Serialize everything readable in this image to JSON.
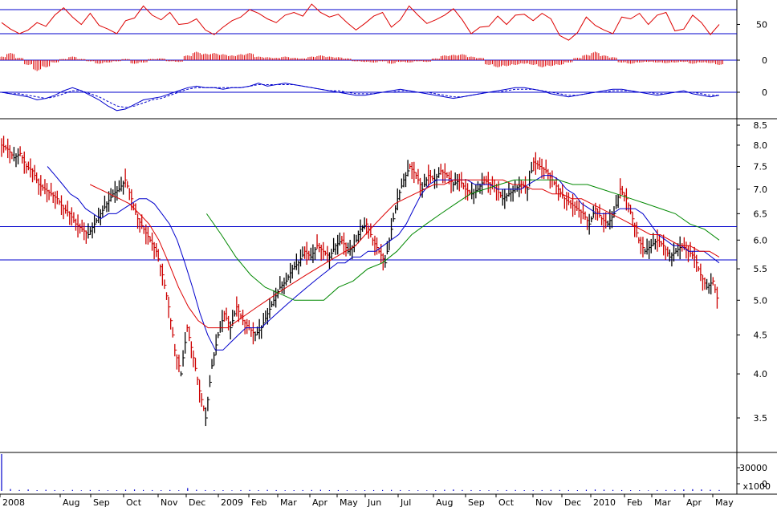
{
  "chart_data": [
    {
      "type": "line",
      "panel": "oscillator",
      "hlines": [
        66,
        40
      ],
      "y_ticks": [
        "50"
      ],
      "series": [
        {
          "color": "#dd0000",
          "values": [
            52,
            45,
            40,
            44,
            52,
            48,
            60,
            68,
            58,
            50,
            62,
            49,
            45,
            40,
            54,
            57,
            70,
            60,
            55,
            63,
            50,
            51,
            56,
            44,
            39,
            47,
            54,
            58,
            66,
            62,
            56,
            52,
            60,
            63,
            59,
            72,
            63,
            58,
            61,
            52,
            44,
            51,
            59,
            63,
            47,
            55,
            70,
            60,
            51,
            55,
            60,
            67,
            55,
            40,
            47,
            48,
            59,
            50,
            60,
            61,
            54,
            62,
            56,
            38,
            33,
            41,
            58,
            49,
            44,
            40,
            58,
            56,
            62,
            50,
            60,
            63,
            43,
            45,
            60,
            52,
            39,
            50
          ]
        }
      ]
    },
    {
      "type": "bar",
      "panel": "histogram",
      "baseline": 0,
      "y_ticks": [
        "0"
      ],
      "series": [
        {
          "color": "#dd0000",
          "values": [
            6,
            12,
            4,
            -8,
            -18,
            -12,
            -4,
            2,
            6,
            2,
            -2,
            -6,
            -4,
            -2,
            2,
            -6,
            -4,
            2,
            3,
            -2,
            -3,
            8,
            14,
            11,
            12,
            10,
            8,
            10,
            12,
            6,
            5,
            4,
            6,
            4,
            3,
            6,
            8,
            6,
            5,
            3,
            -2,
            -3,
            -4,
            -2,
            -6,
            -3,
            -4,
            -2,
            -3,
            3,
            8,
            9,
            10,
            6,
            4,
            -8,
            -12,
            -10,
            -8,
            -6,
            -8,
            -12,
            -10,
            -8,
            -4,
            4,
            9,
            14,
            8,
            5,
            -4,
            -6,
            -4,
            -3,
            -4,
            -5,
            -4,
            -3,
            -6,
            -4,
            -5,
            -8
          ]
        }
      ]
    },
    {
      "type": "line",
      "panel": "macd",
      "baseline": 0,
      "y_ticks": [
        "0"
      ],
      "series": [
        {
          "color": "#0000cc",
          "values": [
            0,
            -1,
            -2,
            -3,
            -5,
            -4,
            -2,
            1,
            3,
            1,
            -2,
            -5,
            -9,
            -12,
            -11,
            -8,
            -5,
            -4,
            -3,
            -1,
            1,
            3,
            4,
            3,
            3,
            2,
            3,
            3,
            4,
            6,
            4,
            5,
            6,
            5,
            4,
            3,
            2,
            1,
            0,
            -1,
            -2,
            -2,
            -1,
            0,
            1,
            2,
            1,
            0,
            -1,
            -2,
            -3,
            -4,
            -3,
            -2,
            -1,
            0,
            1,
            2,
            3,
            3,
            2,
            1,
            -1,
            -2,
            -3,
            -2,
            -1,
            0,
            1,
            2,
            2,
            1,
            0,
            -1,
            -2,
            -1,
            0,
            1,
            -1,
            -2,
            -3,
            -2
          ]
        },
        {
          "color": "#0000cc",
          "dashed": true,
          "values": [
            0,
            -1,
            -1,
            -2,
            -3,
            -4,
            -3,
            -1,
            1,
            1,
            -1,
            -3,
            -6,
            -9,
            -10,
            -9,
            -7,
            -5,
            -4,
            -2,
            0,
            2,
            3,
            3,
            3,
            3,
            3,
            3,
            4,
            5,
            5,
            5,
            5,
            5,
            4,
            3,
            2,
            1,
            1,
            0,
            -1,
            -1,
            -1,
            0,
            0,
            1,
            1,
            0,
            0,
            -1,
            -2,
            -3,
            -3,
            -2,
            -1,
            0,
            0,
            1,
            2,
            2,
            2,
            1,
            0,
            -1,
            -2,
            -2,
            -1,
            0,
            0,
            1,
            1,
            1,
            0,
            0,
            -1,
            -1,
            0,
            0,
            0,
            -1,
            -2,
            -2
          ]
        }
      ]
    },
    {
      "type": "line",
      "panel": "price",
      "scale": "log",
      "ylim": [
        3.2,
        8.7
      ],
      "hlines": [
        6.25,
        5.65
      ],
      "y_ticks": [
        "3.5",
        "4.0",
        "4.5",
        "5.0",
        "5.5",
        "6.0",
        "6.5",
        "7.0",
        "7.5",
        "8.0",
        "8.5"
      ],
      "x_ticks": [
        "2008",
        "Aug",
        "Sep",
        "Oct",
        "Nov",
        "Dec",
        "2009",
        "Feb",
        "Mar",
        "Apr",
        "May",
        "Jun",
        "Jul",
        "Aug",
        "Sep",
        "Oct",
        "Nov",
        "Dec",
        "2010",
        "Feb",
        "Mar",
        "Apr",
        "May"
      ],
      "series": [
        {
          "name": "",
          "color": "#cc0000",
          "values": [
            8.0,
            7.9,
            7.7,
            7.8,
            7.5,
            7.4,
            7.1,
            7.0,
            6.9,
            6.8,
            6.6,
            6.5,
            6.3,
            6.2,
            6.1,
            6.3,
            6.5,
            6.7,
            6.9,
            7.0,
            7.2,
            6.8,
            6.4,
            6.2,
            6.0,
            5.8,
            5.4,
            4.9,
            4.3,
            4.0,
            4.6,
            4.2,
            3.8,
            3.5,
            4.1,
            4.5,
            4.8,
            4.6,
            4.9,
            4.7,
            4.6,
            4.5,
            4.6,
            4.8,
            5.0,
            5.2,
            5.3,
            5.5,
            5.6,
            5.8,
            5.7,
            5.9,
            5.8,
            5.7,
            5.9,
            6.0,
            5.8,
            5.9,
            6.2,
            6.3,
            6.0,
            5.8,
            5.6,
            6.2,
            6.8,
            7.2,
            7.5,
            7.3,
            7.0,
            7.3,
            7.2,
            7.4,
            7.3,
            7.1,
            7.2,
            7.0,
            6.9,
            7.0,
            7.2,
            7.1,
            7.0,
            6.8,
            6.9,
            7.0,
            7.1,
            7.0,
            7.6,
            7.5,
            7.4,
            7.2,
            7.0,
            6.8,
            6.7,
            6.6,
            6.5,
            6.3,
            6.6,
            6.4,
            6.3,
            6.5,
            7.0,
            6.8,
            6.4,
            6.0,
            5.8,
            5.9,
            6.0,
            5.9,
            5.7,
            5.8,
            5.9,
            5.8,
            5.7,
            5.4,
            5.2,
            5.3,
            4.9
          ]
        },
        {
          "name": "",
          "color": "#0000cc",
          "values": [
            null,
            null,
            null,
            null,
            null,
            null,
            7.5,
            7.3,
            7.1,
            6.9,
            6.8,
            6.6,
            6.5,
            6.4,
            6.5,
            6.5,
            6.6,
            6.7,
            6.8,
            6.8,
            6.7,
            6.5,
            6.3,
            6.0,
            5.6,
            5.2,
            4.8,
            4.5,
            4.3,
            4.3,
            4.4,
            4.5,
            4.6,
            4.6,
            4.6,
            4.7,
            4.8,
            4.9,
            5.0,
            5.1,
            5.2,
            5.3,
            5.4,
            5.5,
            5.6,
            5.6,
            5.7,
            5.7,
            5.8,
            5.8,
            5.9,
            6.0,
            6.1,
            6.3,
            6.6,
            6.9,
            7.1,
            7.2,
            7.2,
            7.2,
            7.2,
            7.2,
            7.1,
            7.1,
            7.1,
            7.0,
            7.0,
            7.0,
            7.0,
            7.1,
            7.2,
            7.3,
            7.3,
            7.2,
            7.0,
            6.9,
            6.7,
            6.6,
            6.5,
            6.5,
            6.5,
            6.6,
            6.6,
            6.6,
            6.5,
            6.3,
            6.1,
            6.0,
            5.9,
            5.9,
            5.8,
            5.8,
            5.8,
            5.7,
            5.6
          ]
        },
        {
          "name": "",
          "color": "#dd0000",
          "values": [
            null,
            null,
            null,
            null,
            null,
            null,
            null,
            null,
            null,
            7.1,
            7.0,
            6.9,
            6.8,
            6.7,
            6.5,
            6.3,
            6.0,
            5.6,
            5.2,
            4.9,
            4.7,
            4.6,
            4.6,
            4.6,
            4.7,
            4.8,
            4.9,
            5.0,
            5.1,
            5.2,
            5.3,
            5.4,
            5.5,
            5.6,
            5.7,
            5.8,
            5.9,
            6.1,
            6.3,
            6.5,
            6.7,
            6.8,
            6.9,
            7.0,
            7.1,
            7.1,
            7.2,
            7.2,
            7.2,
            7.2,
            7.2,
            7.2,
            7.1,
            7.1,
            7.0,
            7.0,
            6.9,
            6.9,
            6.8,
            6.8,
            6.7,
            6.6,
            6.5,
            6.4,
            6.3,
            6.2,
            6.1,
            6.1,
            6.0,
            5.9,
            5.9,
            5.8,
            5.8,
            5.7
          ]
        },
        {
          "name": "",
          "color": "#008800",
          "values": [
            null,
            null,
            null,
            null,
            null,
            null,
            null,
            null,
            null,
            null,
            null,
            null,
            null,
            null,
            6.5,
            6.1,
            5.7,
            5.4,
            5.2,
            5.1,
            5.0,
            5.0,
            5.0,
            5.2,
            5.3,
            5.5,
            5.6,
            5.8,
            6.1,
            6.3,
            6.5,
            6.7,
            6.9,
            7.0,
            7.1,
            7.2,
            7.2,
            7.2,
            7.2,
            7.1,
            7.1,
            7.0,
            6.9,
            6.8,
            6.7,
            6.6,
            6.5,
            6.3,
            6.2,
            6.0
          ]
        }
      ]
    },
    {
      "type": "bar",
      "panel": "volume",
      "y_ticks": [
        "30000",
        "0"
      ],
      "unit": "x1000",
      "series": [
        {
          "color": "#0000cc",
          "values": [
            40000,
            2000,
            1000,
            1500,
            800,
            1200,
            900,
            700,
            1100,
            600,
            1000,
            900,
            700,
            800,
            1200,
            1500,
            1000,
            900,
            800,
            1000,
            700,
            3000,
            1200,
            900,
            700,
            800,
            600,
            900,
            1000,
            800,
            1100,
            900,
            700,
            800,
            900,
            1000,
            1200,
            800,
            900,
            700,
            600,
            800,
            900,
            1000,
            1100,
            900,
            800,
            700,
            600,
            800,
            1200,
            1500,
            1000,
            900,
            800,
            700,
            600,
            900,
            1000,
            800,
            700,
            900,
            1100,
            1000,
            900,
            800,
            1200,
            1500,
            1300,
            1100,
            900,
            800,
            700,
            600,
            900,
            1000,
            1100,
            1500,
            1800,
            1600,
            1200,
            1000
          ]
        }
      ]
    }
  ]
}
